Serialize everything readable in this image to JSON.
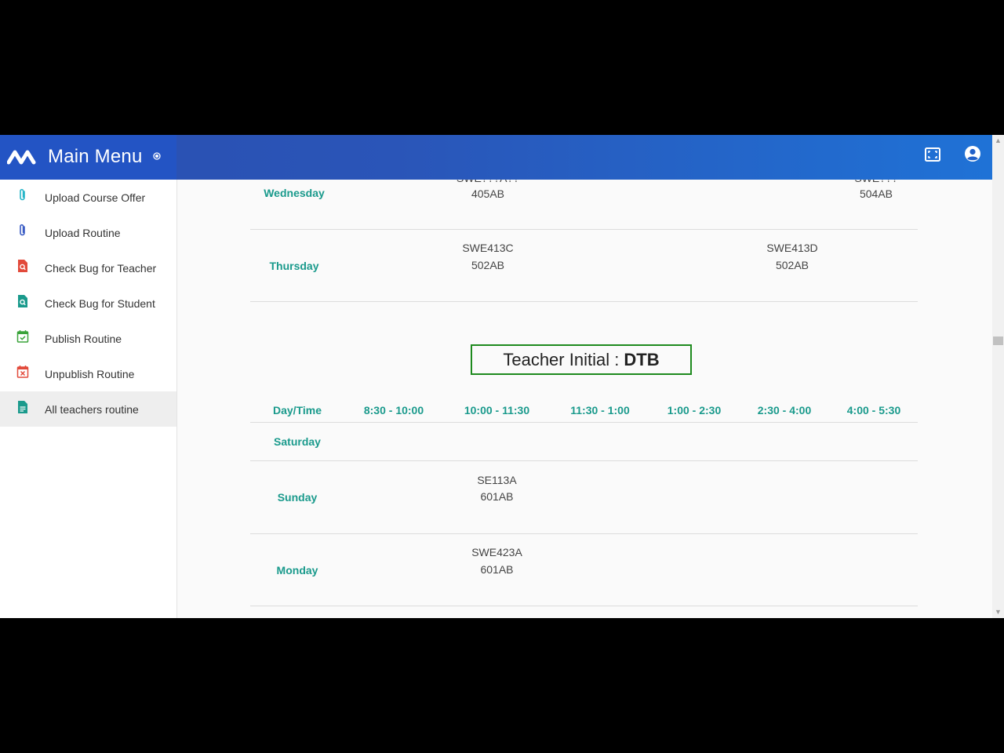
{
  "header": {
    "title": "Main Menu"
  },
  "sidebar": {
    "items": [
      {
        "label": "Upload Course Offer",
        "icon": "paperclip-icon",
        "color": "#26b5c8"
      },
      {
        "label": "Upload Routine",
        "icon": "paperclip-icon",
        "color": "#3a5cc4"
      },
      {
        "label": "Check Bug for Teacher",
        "icon": "file-search-icon",
        "color": "#e24a3b"
      },
      {
        "label": "Check Bug for Student",
        "icon": "file-search-icon",
        "color": "#1a9a8c"
      },
      {
        "label": "Publish Routine",
        "icon": "calendar-check-icon",
        "color": "#3aa33a"
      },
      {
        "label": "Unpublish Routine",
        "icon": "calendar-x-icon",
        "color": "#e24a3b"
      },
      {
        "label": "All teachers routine",
        "icon": "document-icon",
        "color": "#1a9a8c"
      }
    ]
  },
  "routine_prev": {
    "rows": [
      {
        "day": "Wednesday",
        "cells": [
          {
            "code": "SWE???A??",
            "room": "405AB"
          },
          {
            "code": "SWE???",
            "room": "504AB"
          }
        ]
      },
      {
        "day": "Thursday",
        "cells": [
          {
            "code": "SWE413C",
            "room": "502AB"
          },
          {
            "code": "SWE413D",
            "room": "502AB"
          }
        ]
      }
    ]
  },
  "teacher": {
    "label": "Teacher Initial : ",
    "initial": "DTB"
  },
  "routine": {
    "headers": [
      "Day/Time",
      "8:30 - 10:00",
      "10:00 - 11:30",
      "11:30 - 1:00",
      "1:00 - 2:30",
      "2:30 - 4:00",
      "4:00 - 5:30"
    ],
    "rows": [
      {
        "day": "Saturday",
        "cells": []
      },
      {
        "day": "Sunday",
        "cells": [
          {
            "code": "SE113A",
            "room": "601AB"
          }
        ]
      },
      {
        "day": "Monday",
        "cells": [
          {
            "code": "SWE423A",
            "room": "601AB"
          }
        ]
      }
    ]
  },
  "colors": {
    "header_gradient_start": "#2a4fb0",
    "header_gradient_end": "#1f72d6",
    "accent_teal": "#1a9a8c",
    "teacher_box_border": "#1e8a1e"
  }
}
